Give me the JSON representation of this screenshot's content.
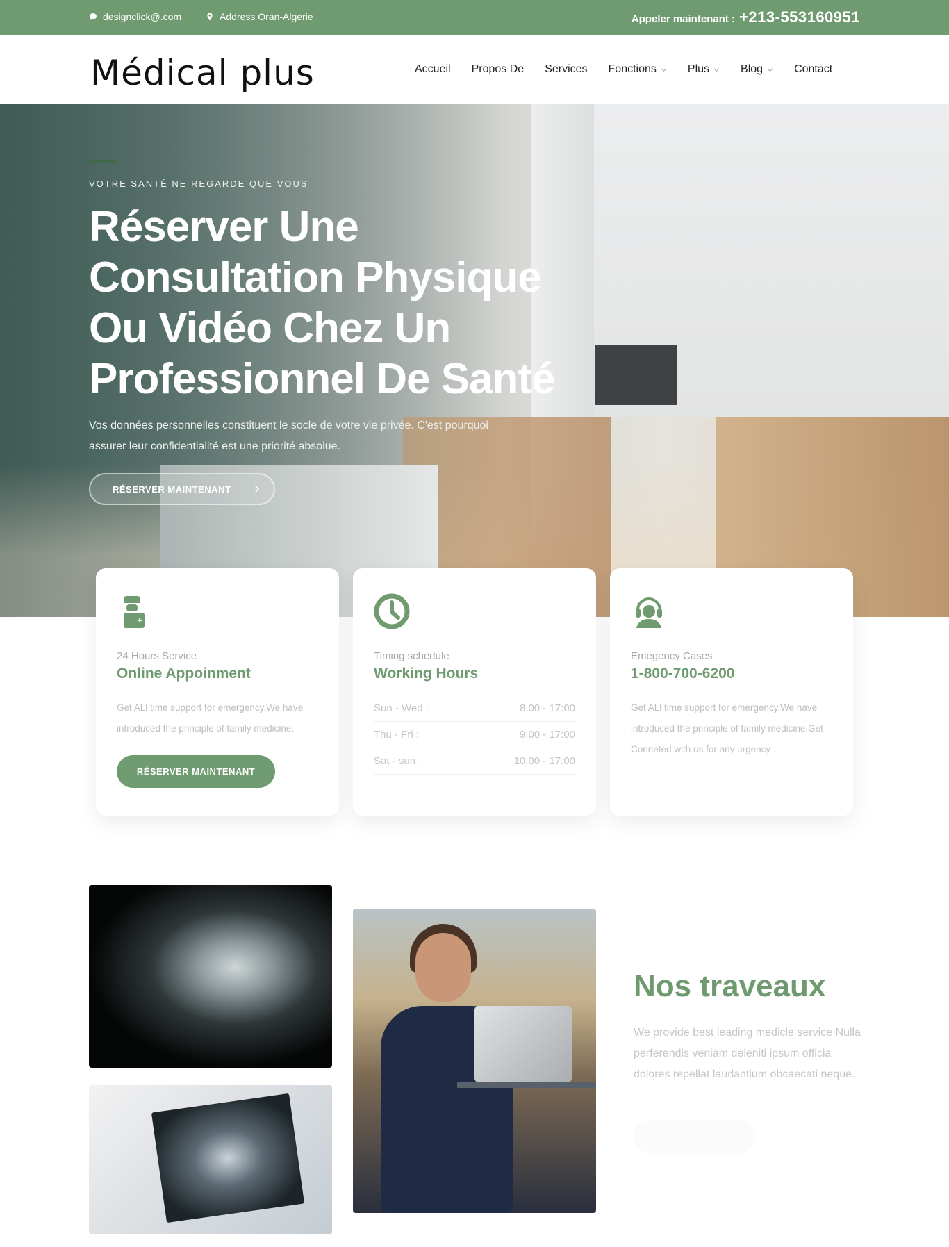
{
  "topbar": {
    "email": "designclick@.com",
    "address": "Address Oran-Algerie",
    "call_label": "Appeler maintenant :",
    "call_number": "+213-553160951"
  },
  "header": {
    "logo": "Médical plus",
    "menu": [
      {
        "label": "Accueil",
        "dropdown": false
      },
      {
        "label": "Propos De",
        "dropdown": false
      },
      {
        "label": "Services",
        "dropdown": false
      },
      {
        "label": "Fonctions",
        "dropdown": true
      },
      {
        "label": "Plus",
        "dropdown": true
      },
      {
        "label": "Blog",
        "dropdown": true
      },
      {
        "label": "Contact",
        "dropdown": false
      }
    ]
  },
  "hero": {
    "eyebrow": "VOTRE SANTÉ NE REGARDE QUE VOUS",
    "title_lines": [
      "Réserver Une",
      "Consultation Physique",
      "Ou Vidéo Chez Un",
      "Professionnel De Santé"
    ],
    "description": "Vos données personnelles constituent le socle de votre vie privée. C'est pourquoi assurer leur confidentialité est une priorité absolue.",
    "button": "RÉSERVER MAINTENANT",
    "button_icon": "chevron-right-icon"
  },
  "cards": {
    "appointment": {
      "icon": "doctor-icon",
      "subtitle": "24 Hours Service",
      "title": "Online Appoinment",
      "text": "Get ALl time support for emergency.We have introduced the principle of family medicine.",
      "button": "RÉSERVER MAINTENANT"
    },
    "hours": {
      "icon": "clock-icon",
      "subtitle": "Timing schedule",
      "title": "Working Hours",
      "rows": [
        {
          "day": "Sun - Wed :",
          "time": "8:00 - 17:00"
        },
        {
          "day": "Thu - Fri :",
          "time": "9:00 - 17:00"
        },
        {
          "day": "Sat - sun :",
          "time": "10:00 - 17:00"
        }
      ]
    },
    "emergency": {
      "icon": "headset-icon",
      "subtitle": "Emegency Cases",
      "title": "1-800-700-6200",
      "text": "Get ALl time support for emergency.We have introduced the principle of family medicine.Get Conneted with us for any urgency ."
    }
  },
  "works": {
    "title": "Nos traveaux",
    "text": "We provide best leading medicle service Nulla perferendis veniam deleniti ipsum officia dolores repellat laudantium obcaecati neque."
  },
  "colors": {
    "brand_green": "#709b70",
    "title_green": "#6f9a6f"
  }
}
